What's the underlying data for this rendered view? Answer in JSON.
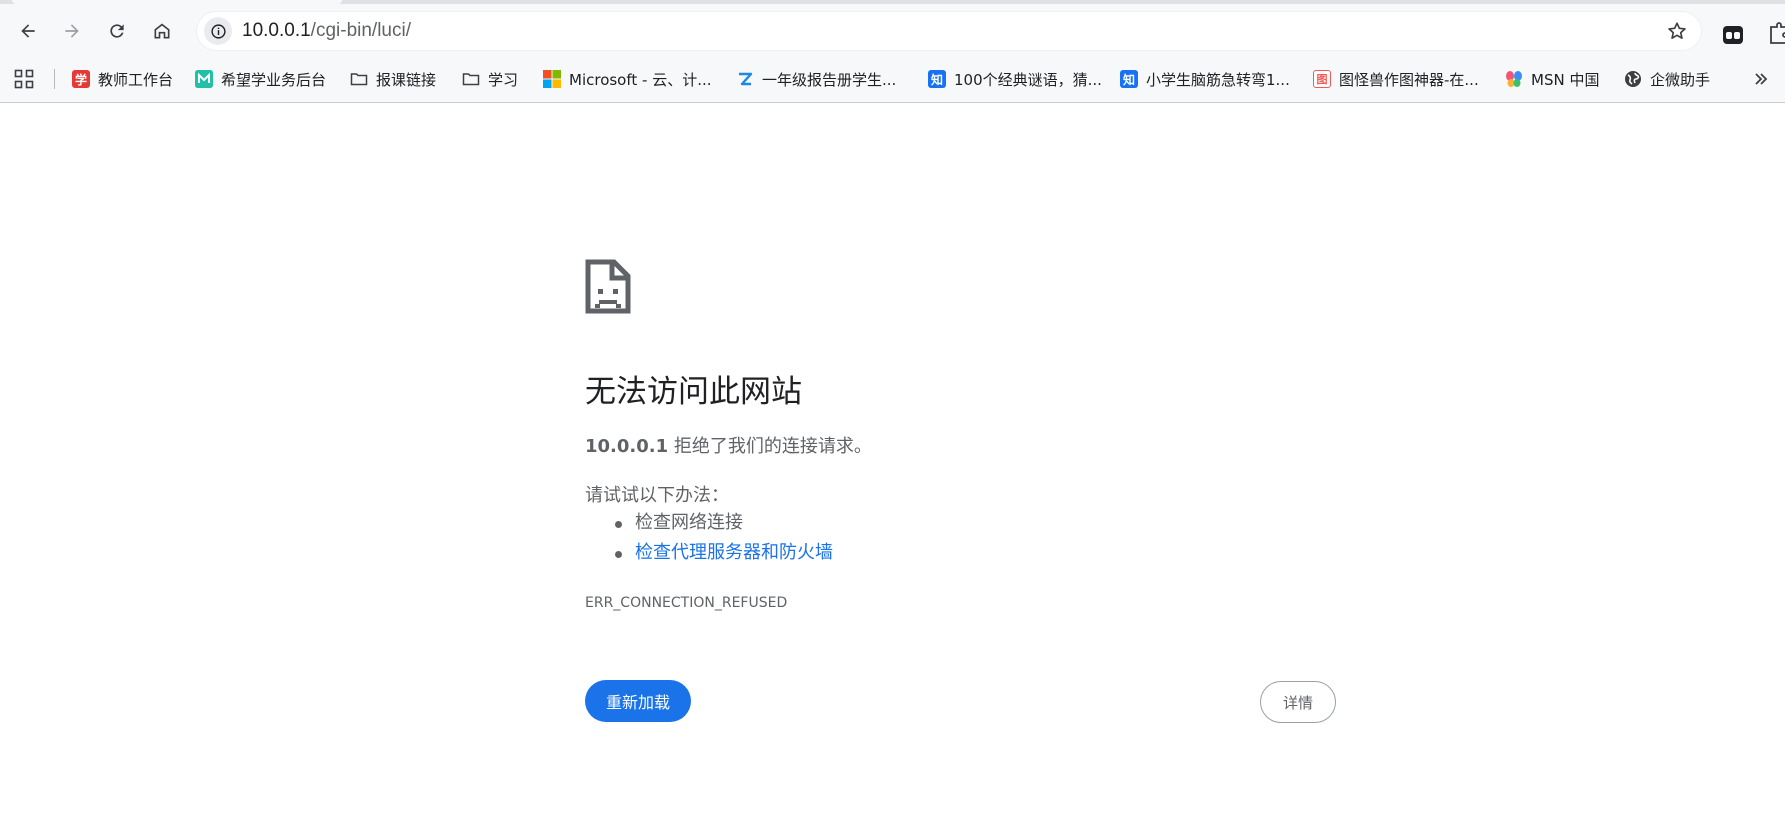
{
  "address_bar": {
    "host": "10.0.0.1",
    "path": "/cgi-bin/luci/"
  },
  "bookmarks": [
    {
      "label": "教师工作台",
      "icon": "xue-icon",
      "icon_text": "学",
      "color": "#e53935"
    },
    {
      "label": "希望学业务后台",
      "icon": "xiwang-icon",
      "color": "#22c1a7"
    },
    {
      "label": "报课链接",
      "icon": "folder-icon"
    },
    {
      "label": "学习",
      "icon": "folder-icon"
    },
    {
      "label": "Microsoft - 云、计...",
      "icon": "microsoft-icon"
    },
    {
      "label": "一年级报告册学生...",
      "icon": "z-logo-icon",
      "color": "#1e88e5"
    },
    {
      "label": "100个经典谜语，猜...",
      "icon": "zhihu-icon",
      "icon_text": "知",
      "color": "#1772f6"
    },
    {
      "label": "小学生脑筋急转弯1...",
      "icon": "zhihu-icon",
      "icon_text": "知",
      "color": "#1772f6"
    },
    {
      "label": "图怪兽作图神器-在...",
      "icon": "tuguaishou-icon",
      "icon_text": "图",
      "color": "#f05a5a"
    },
    {
      "label": "MSN 中国",
      "icon": "msn-butterfly-icon"
    },
    {
      "label": "企微助手",
      "icon": "globe-icon"
    }
  ],
  "error": {
    "title": "无法访问此网站",
    "host": "10.0.0.1",
    "message": " 拒绝了我们的连接请求。",
    "suggest_heading": "请试试以下办法：",
    "suggestions": [
      "检查网络连接",
      "检查代理服务器和防火墙"
    ],
    "code": "ERR_CONNECTION_REFUSED",
    "reload_label": "重新加载",
    "details_label": "详情"
  },
  "colors": {
    "accent": "#1a73e8",
    "text": "#202124",
    "secondary_text": "#5f6368",
    "chrome_bg": "#f7f8fa"
  }
}
